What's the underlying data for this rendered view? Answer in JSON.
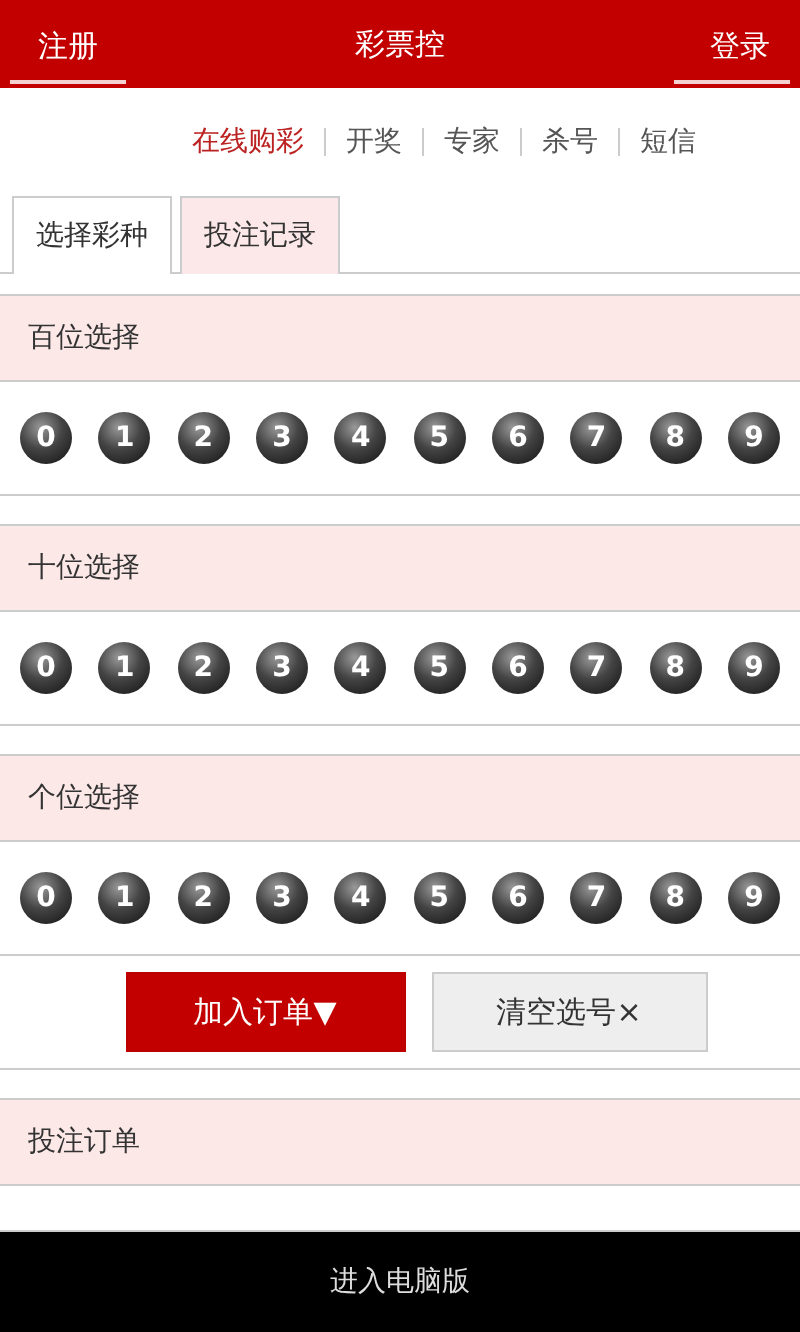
{
  "header": {
    "left": "注册",
    "title": "彩票控",
    "right": "登录"
  },
  "nav": [
    {
      "label": "在线购彩",
      "selected": true
    },
    {
      "label": "开奖",
      "selected": false
    },
    {
      "label": "专家",
      "selected": false
    },
    {
      "label": "杀号",
      "selected": false
    },
    {
      "label": "短信",
      "selected": false
    }
  ],
  "tabs": [
    {
      "label": "选择彩种",
      "selected": true
    },
    {
      "label": "投注记录",
      "selected": false
    }
  ],
  "sections": [
    {
      "title": "百位选择",
      "balls": [
        "0",
        "1",
        "2",
        "3",
        "4",
        "5",
        "6",
        "7",
        "8",
        "9"
      ]
    },
    {
      "title": "十位选择",
      "balls": [
        "0",
        "1",
        "2",
        "3",
        "4",
        "5",
        "6",
        "7",
        "8",
        "9"
      ]
    },
    {
      "title": "个位选择",
      "balls": [
        "0",
        "1",
        "2",
        "3",
        "4",
        "5",
        "6",
        "7",
        "8",
        "9"
      ]
    }
  ],
  "buttons": [
    {
      "label": "加入订单▼",
      "kind": "primary"
    },
    {
      "label": "清空选号×",
      "kind": "secondary"
    }
  ],
  "order": {
    "title": "投注订单"
  },
  "footer": "进入电脑版"
}
